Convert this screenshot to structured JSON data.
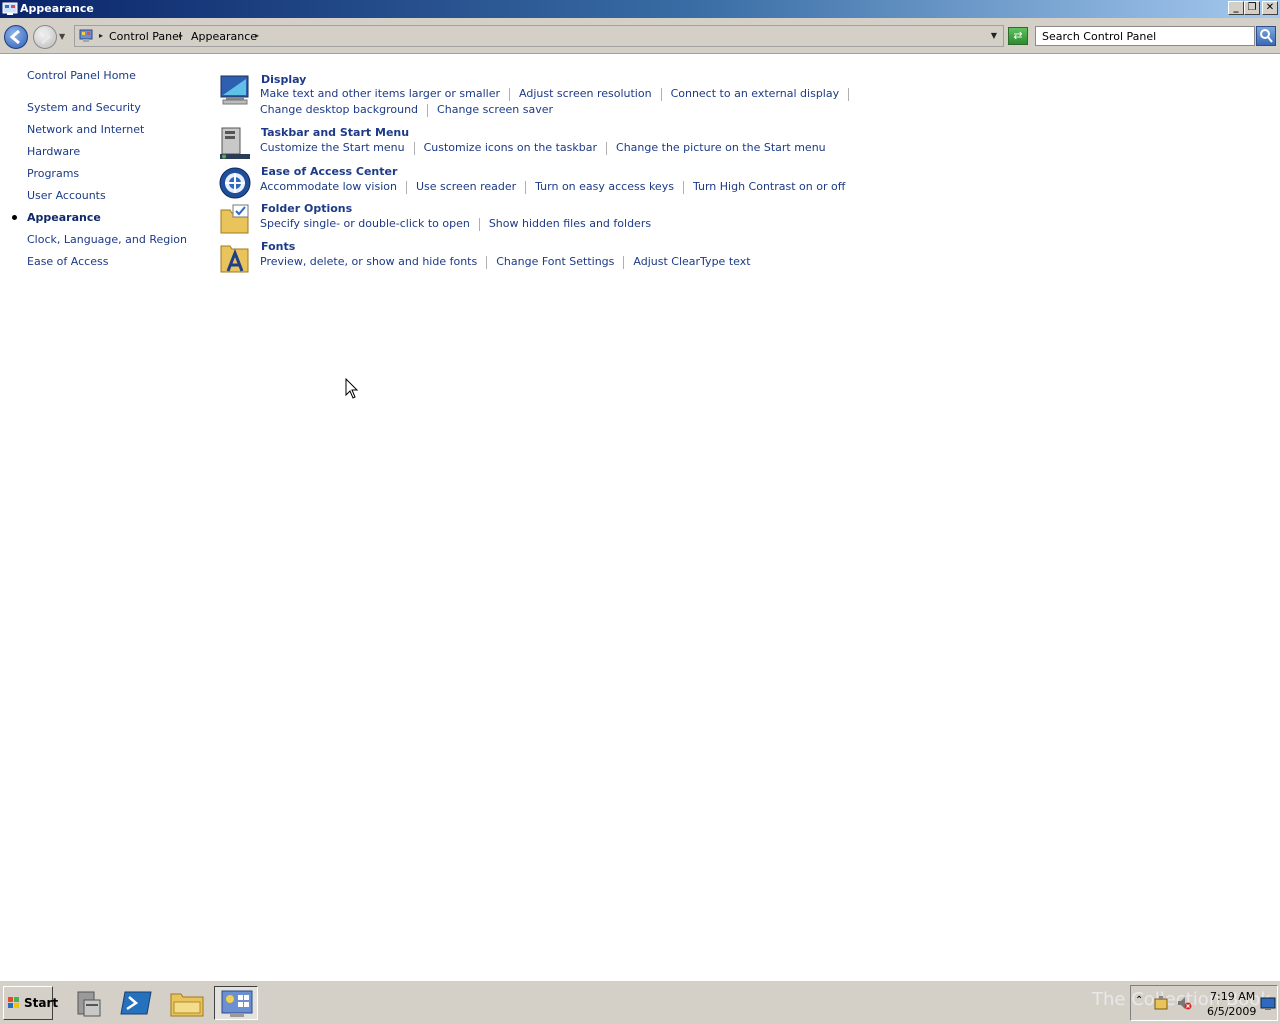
{
  "window": {
    "title": "Appearance"
  },
  "address": {
    "crumbs": [
      "Control Panel",
      "Appearance"
    ],
    "search_placeholder": "Search Control Panel"
  },
  "sidebar": {
    "home": "Control Panel Home",
    "items": [
      {
        "label": "System and Security"
      },
      {
        "label": "Network and Internet"
      },
      {
        "label": "Hardware"
      },
      {
        "label": "Programs"
      },
      {
        "label": "User Accounts"
      },
      {
        "label": "Appearance",
        "current": true
      },
      {
        "label": "Clock, Language, and Region"
      },
      {
        "label": "Ease of Access"
      }
    ]
  },
  "categories": [
    {
      "title": "Display",
      "icon": "display-icon",
      "links": [
        [
          "Make text and other items larger or smaller",
          "Adjust screen resolution",
          "Connect to an external display"
        ],
        [
          "Change desktop background",
          "Change screen saver"
        ]
      ]
    },
    {
      "title": "Taskbar and Start Menu",
      "icon": "taskbar-icon",
      "links": [
        [
          "Customize the Start menu",
          "Customize icons on the taskbar",
          "Change the picture on the Start menu"
        ]
      ]
    },
    {
      "title": "Ease of Access Center",
      "icon": "ease-of-access-icon",
      "links": [
        [
          "Accommodate low vision",
          "Use screen reader",
          "Turn on easy access keys",
          "Turn High Contrast on or off"
        ]
      ]
    },
    {
      "title": "Folder Options",
      "icon": "folder-options-icon",
      "links": [
        [
          "Specify single- or double-click to open",
          "Show hidden files and folders"
        ]
      ]
    },
    {
      "title": "Fonts",
      "icon": "fonts-icon",
      "links": [
        [
          "Preview, delete, or show and hide fonts",
          "Change Font Settings",
          "Adjust ClearType text"
        ]
      ]
    }
  ],
  "taskbar": {
    "start_label": "Start",
    "apps": [
      "server-manager-icon",
      "powershell-icon",
      "explorer-icon",
      "control-panel-icon"
    ],
    "time": "7:19 AM",
    "date": "6/5/2009",
    "watermark": "The Collection Book"
  },
  "colors": {
    "link": "#1c3a87",
    "titlebar_start": "#0a246a",
    "chrome": "#d4d0c8"
  }
}
